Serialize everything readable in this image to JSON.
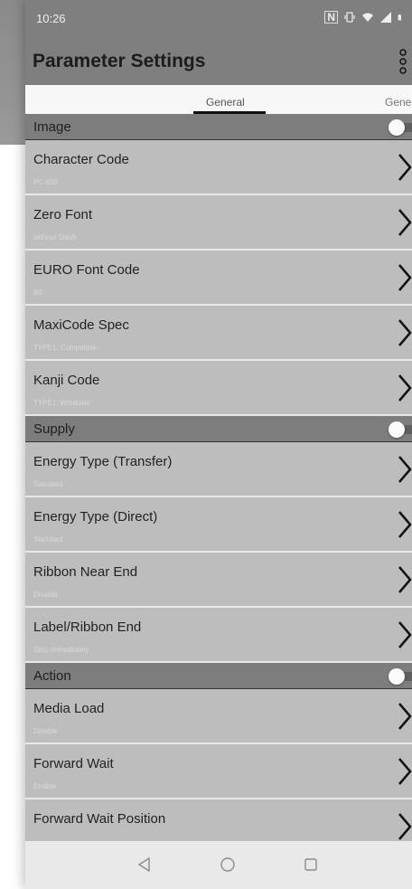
{
  "status": {
    "time": "10:26",
    "nfc_label": "N"
  },
  "appbar": {
    "title": "Parameter Settings"
  },
  "tabs": [
    {
      "label": "General"
    },
    {
      "label": "Genera"
    }
  ],
  "sections": {
    "image": {
      "label": "Image",
      "items": [
        {
          "name": "Character Code",
          "value": "PC-850"
        },
        {
          "name": "Zero Font",
          "value": "without Slash"
        },
        {
          "name": "EURO Font Code",
          "value": "B0"
        },
        {
          "name": "MaxiCode Spec",
          "value": "TYPE1: Compatible"
        },
        {
          "name": "Kanji Code",
          "value": "TYPE1: Windows"
        }
      ]
    },
    "supply": {
      "label": "Supply",
      "items": [
        {
          "name": "Energy Type (Transfer)",
          "value": "Standard"
        },
        {
          "name": "Energy Type (Direct)",
          "value": "Standard"
        },
        {
          "name": "Ribbon Near End",
          "value": "Disable"
        },
        {
          "name": "Label/Ribbon End",
          "value": "Stop immediately"
        }
      ]
    },
    "action": {
      "label": "Action",
      "items": [
        {
          "name": "Media Load",
          "value": "Disable"
        },
        {
          "name": "Forward Wait",
          "value": "Enable"
        },
        {
          "name": "Forward Wait Position",
          "value": ""
        }
      ]
    }
  },
  "icons": {
    "menu": "overflow-menu-icon",
    "chevron": "chevron-right-icon",
    "back": "back-triangle-icon",
    "home": "home-circle-icon",
    "recents": "recents-square-icon"
  }
}
